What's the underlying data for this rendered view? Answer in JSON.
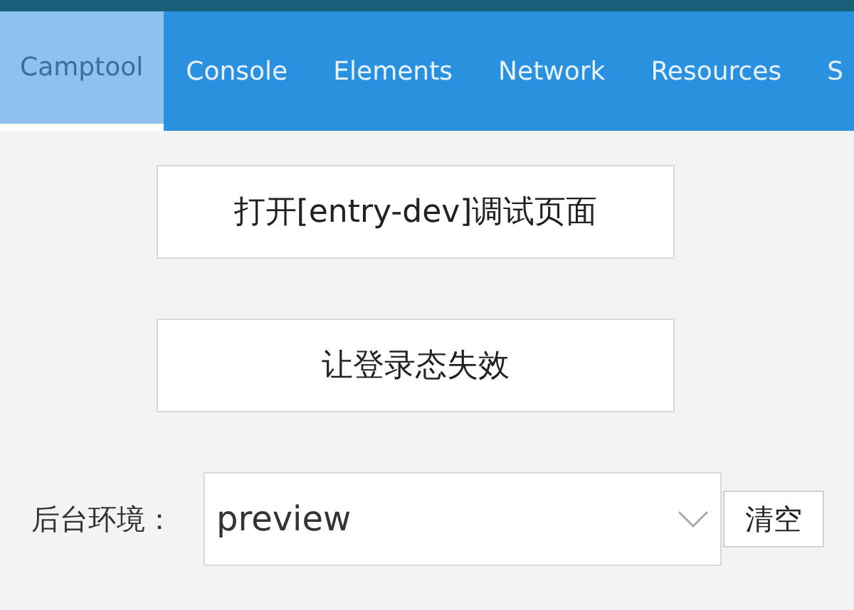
{
  "tabs": [
    {
      "label": "Camptool",
      "selected": true
    },
    {
      "label": "Console",
      "selected": false
    },
    {
      "label": "Elements",
      "selected": false
    },
    {
      "label": "Network",
      "selected": false
    },
    {
      "label": "Resources",
      "selected": false
    },
    {
      "label": "S",
      "selected": false
    }
  ],
  "buttons": [
    "打开[entry-dev]调试页面",
    "让登录态失效"
  ],
  "env": {
    "label": "后台环境：",
    "value": "preview",
    "clear_button": "清空"
  }
}
